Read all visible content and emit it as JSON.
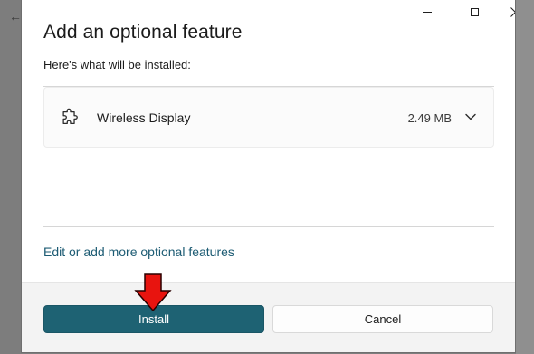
{
  "window": {
    "back_glyph": "←",
    "controls": {
      "minimize_icon": "minimize-icon",
      "maximize_icon": "maximize-icon",
      "close_icon": "close-icon"
    }
  },
  "dialog": {
    "title": "Add an optional feature",
    "subtitle": "Here's what will be installed:",
    "features": [
      {
        "name": "Wireless Display",
        "size": "2.49 MB",
        "icon": "puzzle-piece-icon",
        "expand_icon": "chevron-down-icon"
      }
    ],
    "link": "Edit or add more optional features",
    "buttons": {
      "install": "Install",
      "cancel": "Cancel"
    }
  },
  "annotation": {
    "icon": "red-arrow-down-icon",
    "color": "#e8140f"
  },
  "colors": {
    "accent": "#1e6273",
    "link": "#1c5b73",
    "footer_bg": "#f3f3f3"
  }
}
